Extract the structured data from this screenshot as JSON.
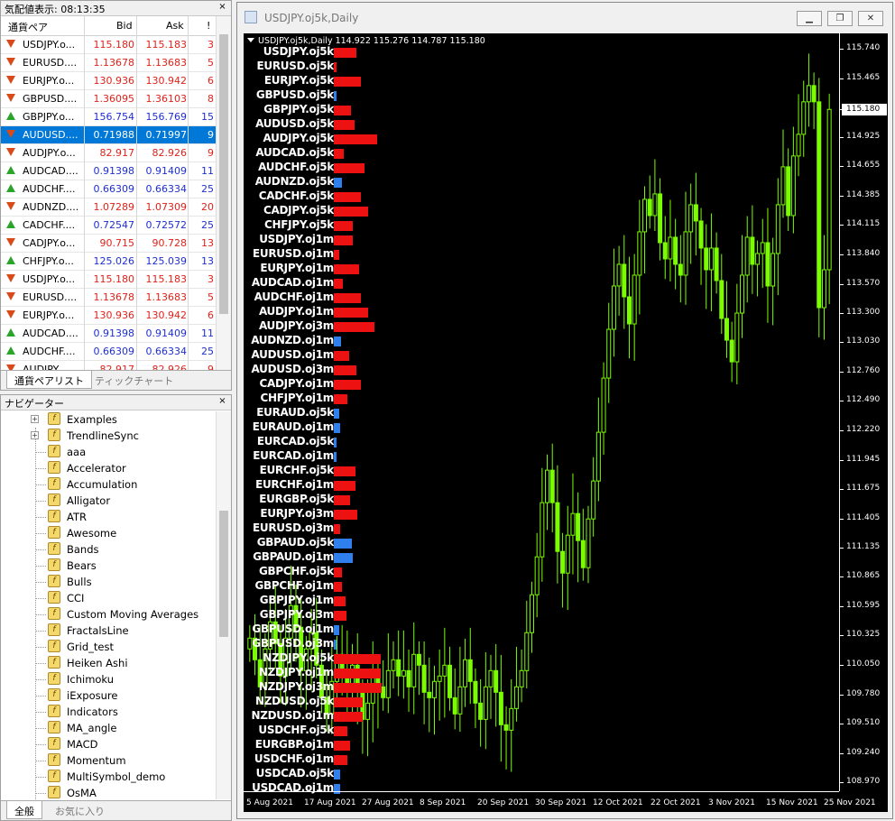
{
  "market_watch": {
    "title": "気配値表示: 08:13:35",
    "columns": {
      "symbol": "通貨ペア",
      "bid": "Bid",
      "ask": "Ask",
      "count": "!"
    },
    "rows": [
      {
        "symbol": "USDJPY.o...",
        "bid": "115.180",
        "ask": "115.183",
        "count": "3",
        "dir": "down",
        "color": "red"
      },
      {
        "symbol": "EURUSD....",
        "bid": "1.13678",
        "ask": "1.13683",
        "count": "5",
        "dir": "down",
        "color": "red"
      },
      {
        "symbol": "EURJPY.o...",
        "bid": "130.936",
        "ask": "130.942",
        "count": "6",
        "dir": "down",
        "color": "red"
      },
      {
        "symbol": "GBPUSD....",
        "bid": "1.36095",
        "ask": "1.36103",
        "count": "8",
        "dir": "down",
        "color": "red"
      },
      {
        "symbol": "GBPJPY.o...",
        "bid": "156.754",
        "ask": "156.769",
        "count": "15",
        "dir": "up",
        "color": "blue"
      },
      {
        "symbol": "AUDUSD....",
        "bid": "0.71988",
        "ask": "0.71997",
        "count": "9",
        "dir": "down",
        "color": "red",
        "selected": true
      },
      {
        "symbol": "AUDJPY.o...",
        "bid": "82.917",
        "ask": "82.926",
        "count": "9",
        "dir": "down",
        "color": "red"
      },
      {
        "symbol": "AUDCAD....",
        "bid": "0.91398",
        "ask": "0.91409",
        "count": "11",
        "dir": "up",
        "color": "blue"
      },
      {
        "symbol": "AUDCHF....",
        "bid": "0.66309",
        "ask": "0.66334",
        "count": "25",
        "dir": "up",
        "color": "blue"
      },
      {
        "symbol": "AUDNZD....",
        "bid": "1.07289",
        "ask": "1.07309",
        "count": "20",
        "dir": "down",
        "color": "red"
      },
      {
        "symbol": "CADCHF....",
        "bid": "0.72547",
        "ask": "0.72572",
        "count": "25",
        "dir": "up",
        "color": "blue"
      },
      {
        "symbol": "CADJPY.o...",
        "bid": "90.715",
        "ask": "90.728",
        "count": "13",
        "dir": "down",
        "color": "red"
      },
      {
        "symbol": "CHFJPY.o...",
        "bid": "125.026",
        "ask": "125.039",
        "count": "13",
        "dir": "up",
        "color": "blue"
      },
      {
        "symbol": "USDJPY.o...",
        "bid": "115.180",
        "ask": "115.183",
        "count": "3",
        "dir": "down",
        "color": "red"
      },
      {
        "symbol": "EURUSD....",
        "bid": "1.13678",
        "ask": "1.13683",
        "count": "5",
        "dir": "down",
        "color": "red"
      },
      {
        "symbol": "EURJPY.o...",
        "bid": "130.936",
        "ask": "130.942",
        "count": "6",
        "dir": "down",
        "color": "red"
      },
      {
        "symbol": "AUDCAD....",
        "bid": "0.91398",
        "ask": "0.91409",
        "count": "11",
        "dir": "up",
        "color": "blue"
      },
      {
        "symbol": "AUDCHF....",
        "bid": "0.66309",
        "ask": "0.66334",
        "count": "25",
        "dir": "up",
        "color": "blue"
      },
      {
        "symbol": "AUDJPY....",
        "bid": "82.917",
        "ask": "82.926",
        "count": "9",
        "dir": "down",
        "color": "red"
      }
    ],
    "tabs": [
      "通貨ペアリスト",
      "ティックチャート"
    ]
  },
  "navigator": {
    "title": "ナビゲーター",
    "items": [
      {
        "label": "Examples",
        "expandable": true
      },
      {
        "label": "TrendlineSync",
        "expandable": true
      },
      {
        "label": "aaa"
      },
      {
        "label": "Accelerator"
      },
      {
        "label": "Accumulation"
      },
      {
        "label": "Alligator"
      },
      {
        "label": "ATR"
      },
      {
        "label": "Awesome"
      },
      {
        "label": "Bands"
      },
      {
        "label": "Bears"
      },
      {
        "label": "Bulls"
      },
      {
        "label": "CCI"
      },
      {
        "label": "Custom Moving Averages"
      },
      {
        "label": "FractalsLine"
      },
      {
        "label": "Grid_test"
      },
      {
        "label": "Heiken Ashi"
      },
      {
        "label": "Ichimoku"
      },
      {
        "label": "iExposure"
      },
      {
        "label": "Indicators"
      },
      {
        "label": "MA_angle"
      },
      {
        "label": "MACD"
      },
      {
        "label": "Momentum"
      },
      {
        "label": "MultiSymbol_demo"
      },
      {
        "label": "OsMA"
      }
    ],
    "tabs": [
      "全般",
      "お気に入り"
    ]
  },
  "chart_window": {
    "title": "USDJPY.oj5k,Daily",
    "info": "USDJPY.oj5k,Daily  114.922 115.276 114.787 115.180",
    "current_price": "115.180",
    "colors": {
      "background": "#000000",
      "candle": "#7cfc00",
      "bar_up": "#ee1111",
      "bar_down": "#2f80ed"
    }
  },
  "chart_data": {
    "type": "candlestick",
    "title": "USDJPY.oj5k,Daily",
    "ohlc_header": {
      "open": 114.922,
      "high": 115.276,
      "low": 114.787,
      "close": 115.18
    },
    "y_ticks": [
      "115.740",
      "115.465",
      "115.180",
      "114.925",
      "114.655",
      "114.385",
      "114.115",
      "113.840",
      "113.570",
      "113.300",
      "113.030",
      "112.760",
      "112.490",
      "112.220",
      "111.945",
      "111.675",
      "111.405",
      "111.135",
      "110.865",
      "110.595",
      "110.325",
      "110.050",
      "109.780",
      "109.510",
      "109.240",
      "108.970"
    ],
    "x_ticks": [
      "5 Aug 2021",
      "17 Aug 2021",
      "27 Aug 2021",
      "8 Sep 2021",
      "20 Sep 2021",
      "30 Sep 2021",
      "12 Oct 2021",
      "22 Oct 2021",
      "3 Nov 2021",
      "15 Nov 2021",
      "25 Nov 2021"
    ],
    "ylim": [
      108.97,
      115.74
    ],
    "closes": [
      110.3,
      110.1,
      109.85,
      110.2,
      110.45,
      110.25,
      109.95,
      110.3,
      110.6,
      110.4,
      110.0,
      110.2,
      110.35,
      110.05,
      109.75,
      109.6,
      109.9,
      110.15,
      110.0,
      109.85,
      110.05,
      109.8,
      109.55,
      109.7,
      109.95,
      109.85,
      109.75,
      110.0,
      110.1,
      109.95,
      110.0,
      109.85,
      110.15,
      110.05,
      109.8,
      109.75,
      109.9,
      109.95,
      110.05,
      109.75,
      109.6,
      109.85,
      110.1,
      109.9,
      109.7,
      109.55,
      109.85,
      110.0,
      109.8,
      109.5,
      109.45,
      109.65,
      109.85,
      110.0,
      110.35,
      110.7,
      111.05,
      111.55,
      111.85,
      111.55,
      111.1,
      110.9,
      111.25,
      111.45,
      111.2,
      110.95,
      111.4,
      111.75,
      112.2,
      112.7,
      113.15,
      113.55,
      113.75,
      113.45,
      113.2,
      113.65,
      114.05,
      114.35,
      114.2,
      114.4,
      113.95,
      113.8,
      114.0,
      113.75,
      113.65,
      114.05,
      114.3,
      114.15,
      113.9,
      113.7,
      113.9,
      113.6,
      113.25,
      113.05,
      112.85,
      113.3,
      113.65,
      114.0,
      113.75,
      113.85,
      113.95,
      113.55,
      113.85,
      114.3,
      114.65,
      114.2,
      114.75,
      114.95,
      115.25,
      115.4,
      115.25,
      113.35,
      113.7,
      115.18
    ],
    "bar_rows": [
      {
        "label": "USDJPY.oj5k",
        "value": 0.25,
        "color": "red"
      },
      {
        "label": "EURUSD.oj5k",
        "value": 0.03,
        "color": "red"
      },
      {
        "label": "EURJPY.oj5k",
        "value": 0.3,
        "color": "red"
      },
      {
        "label": "GBPUSD.oj5k",
        "value": 0.03,
        "color": "blue"
      },
      {
        "label": "GBPJPY.oj5k",
        "value": 0.19,
        "color": "red"
      },
      {
        "label": "AUDUSD.oj5k",
        "value": 0.23,
        "color": "red"
      },
      {
        "label": "AUDJPY.oj5k",
        "value": 0.48,
        "color": "red"
      },
      {
        "label": "AUDCAD.oj5k",
        "value": 0.11,
        "color": "red"
      },
      {
        "label": "AUDCHF.oj5k",
        "value": 0.34,
        "color": "red"
      },
      {
        "label": "AUDNZD.oj5k",
        "value": 0.09,
        "color": "blue"
      },
      {
        "label": "CADCHF.oj5k",
        "value": 0.3,
        "color": "red"
      },
      {
        "label": "CADJPY.oj5k",
        "value": 0.38,
        "color": "red"
      },
      {
        "label": "CHFJPY.oj5k",
        "value": 0.21,
        "color": "red"
      },
      {
        "label": "USDJPY.oj1m",
        "value": 0.21,
        "color": "red"
      },
      {
        "label": "EURUSD.oj1m",
        "value": 0.06,
        "color": "red"
      },
      {
        "label": "EURJPY.oj1m",
        "value": 0.28,
        "color": "red"
      },
      {
        "label": "AUDCAD.oj1m",
        "value": 0.1,
        "color": "red"
      },
      {
        "label": "AUDCHF.oj1m",
        "value": 0.3,
        "color": "red"
      },
      {
        "label": "AUDJPY.oj1m",
        "value": 0.38,
        "color": "red"
      },
      {
        "label": "AUDJPY.oj3m",
        "value": 0.45,
        "color": "red"
      },
      {
        "label": "AUDNZD.oj1m",
        "value": 0.08,
        "color": "blue"
      },
      {
        "label": "AUDUSD.oj1m",
        "value": 0.17,
        "color": "red"
      },
      {
        "label": "AUDUSD.oj3m",
        "value": 0.25,
        "color": "red"
      },
      {
        "label": "CADJPY.oj1m",
        "value": 0.3,
        "color": "red"
      },
      {
        "label": "CHFJPY.oj1m",
        "value": 0.15,
        "color": "red"
      },
      {
        "label": "EURAUD.oj5k",
        "value": 0.06,
        "color": "blue"
      },
      {
        "label": "EURAUD.oj1m",
        "value": 0.07,
        "color": "blue"
      },
      {
        "label": "EURCAD.oj5k",
        "value": 0.03,
        "color": "blue"
      },
      {
        "label": "EURCAD.oj1m",
        "value": 0.03,
        "color": "blue"
      },
      {
        "label": "EURCHF.oj5k",
        "value": 0.24,
        "color": "red"
      },
      {
        "label": "EURCHF.oj1m",
        "value": 0.24,
        "color": "red"
      },
      {
        "label": "EURGBP.oj5k",
        "value": 0.18,
        "color": "red"
      },
      {
        "label": "EURJPY.oj3m",
        "value": 0.26,
        "color": "red"
      },
      {
        "label": "EURUSD.oj3m",
        "value": 0.07,
        "color": "red"
      },
      {
        "label": "GBPAUD.oj5k",
        "value": 0.2,
        "color": "blue"
      },
      {
        "label": "GBPAUD.oj1m",
        "value": 0.21,
        "color": "blue"
      },
      {
        "label": "GBPCHF.oj5k",
        "value": 0.09,
        "color": "red"
      },
      {
        "label": "GBPCHF.oj1m",
        "value": 0.09,
        "color": "red"
      },
      {
        "label": "GBPJPY.oj1m",
        "value": 0.13,
        "color": "red"
      },
      {
        "label": "GBPJPY.oj3m",
        "value": 0.14,
        "color": "red"
      },
      {
        "label": "GBPUSD.oj1m",
        "value": 0.06,
        "color": "blue"
      },
      {
        "label": "GBPUSD.oj3m",
        "value": 0.03,
        "color": "blue"
      },
      {
        "label": "NZDJPY.oj5k",
        "value": 0.52,
        "color": "red"
      },
      {
        "label": "NZDJPY.oj1m",
        "value": 0.52,
        "color": "red"
      },
      {
        "label": "NZDJPY.oj3m",
        "value": 0.53,
        "color": "red"
      },
      {
        "label": "NZDUSD.oj5k",
        "value": 0.32,
        "color": "red"
      },
      {
        "label": "NZDUSD.oj1m",
        "value": 0.32,
        "color": "red"
      },
      {
        "label": "USDCHF.oj5k",
        "value": 0.15,
        "color": "red"
      },
      {
        "label": "EURGBP.oj1m",
        "value": 0.18,
        "color": "red"
      },
      {
        "label": "USDCHF.oj1m",
        "value": 0.15,
        "color": "red"
      },
      {
        "label": "USDCAD.oj5k",
        "value": 0.07,
        "color": "blue"
      },
      {
        "label": "USDCAD.oj1m",
        "value": 0.07,
        "color": "blue"
      }
    ]
  }
}
